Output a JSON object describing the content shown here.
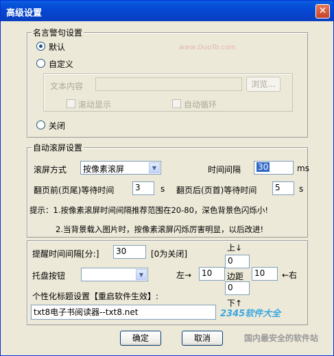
{
  "window": {
    "title": "高级设置",
    "close_glyph": "✕"
  },
  "quote_group": {
    "legend": "名言警句设置",
    "option_default": "默认",
    "option_custom": "自定义",
    "text_content_label": "文本内容",
    "text_content_value": "",
    "browse_button": "浏览...",
    "scroll_display": "滚动显示",
    "auto_loop": "自动循环",
    "option_off": "关闭",
    "selected": "默认"
  },
  "auto_scroll_group": {
    "legend": "自动滚屏设置",
    "scroll_mode_label": "滚屏方式",
    "scroll_mode_value": "按像素滚屏",
    "interval_label": "时间间隔",
    "interval_value": "30",
    "interval_unit": "ms",
    "before_flip_label": "翻页前(页尾)等待时间",
    "before_flip_value": "3",
    "before_flip_unit": "s",
    "after_flip_label": "翻页后(页首)等待时间",
    "after_flip_value": "5",
    "after_flip_unit": "s",
    "hint_1": "提示：1.按像素滚屏时间间隔推荐范围在20-80，深色背景色闪烁小!",
    "hint_2": "2.当背景载入图片时，按像素滚屏闪烁厉害明显，以后改进!"
  },
  "other_group": {
    "reminder_label": "提醒时间间隔[分:]",
    "reminder_value": "30",
    "reminder_note": "[0为关闭]",
    "tray_label": "托盘按钮",
    "tray_value": "",
    "title_label": "个性化标题设置【重启软件生效】:",
    "title_value": "txt8电子书阅读器--txt8.net",
    "margin": {
      "top_label": "上↓",
      "top_value": "0",
      "left_label": "左→",
      "left_value": "10",
      "center_label": "边距",
      "right_value": "10",
      "right_label": "←右",
      "bottom_value": "0",
      "bottom_label": "下↑"
    }
  },
  "buttons": {
    "ok": "确定",
    "cancel": "取消"
  },
  "watermarks": {
    "site_1": "www.DuoTe.com",
    "site_2": "2345软件大全",
    "site_3": "国内最安全的软件站"
  }
}
